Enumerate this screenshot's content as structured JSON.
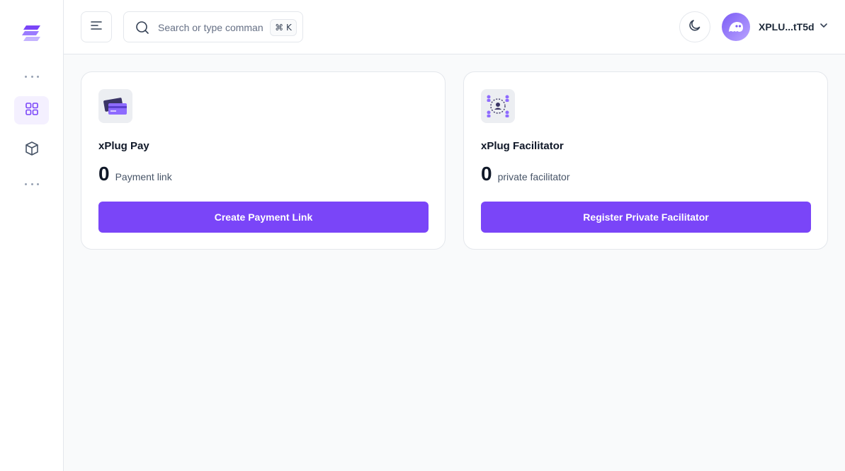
{
  "search": {
    "placeholder": "Search or type comman",
    "shortcut": "⌘ K"
  },
  "user": {
    "name": "XPLU...tT5d"
  },
  "colors": {
    "accent": "#7a45f8",
    "accent_soft": "#f4f0ff"
  },
  "icons": {
    "sidebar": [
      "logo-icon",
      "more-dots-icon",
      "grid-icon",
      "box-icon",
      "more-dots-icon"
    ],
    "header": [
      "menu-icon",
      "search-icon",
      "moon-icon",
      "chevron-down-icon"
    ]
  },
  "cards": [
    {
      "title": "xPlug Pay",
      "count": "0",
      "unit": "Payment link",
      "button": "Create Payment Link",
      "icon": "credit-card-icon"
    },
    {
      "title": "xPlug Facilitator",
      "count": "0",
      "unit": "private facilitator",
      "button": "Register Private Facilitator",
      "icon": "network-icon"
    }
  ]
}
